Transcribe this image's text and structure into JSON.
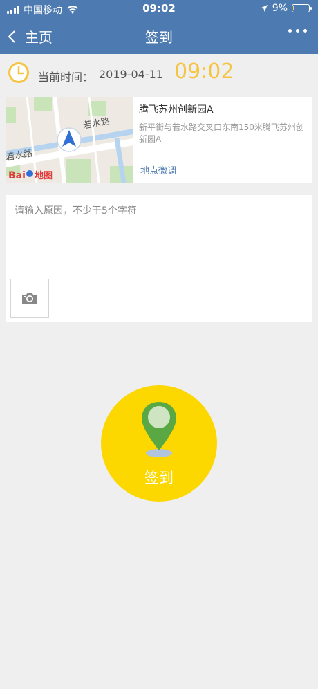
{
  "status_bar": {
    "carrier": "中国移动",
    "time": "09:02",
    "battery": "9%",
    "battery_level": 0.09
  },
  "nav": {
    "back_label": "主页",
    "title": "签到"
  },
  "checkin": {
    "time_label": "当前时间：",
    "date": "2019-04-11",
    "time": "09:02"
  },
  "location": {
    "name": "腾飞苏州创新园A",
    "address": "新平街与若水路交叉口东南150米腾飞苏州创新园A",
    "adjust_label": "地点微调",
    "map": {
      "road_label_1": "若水路",
      "road_label_2": "若水路",
      "brand": "Baidu地图"
    }
  },
  "reason": {
    "placeholder": "请输入原因，不少于5个字符",
    "value": ""
  },
  "signin_button": {
    "label": "签到",
    "color": "#fcd700"
  },
  "colors": {
    "header": "#4d7bb1",
    "accent_time": "#f5c542",
    "link": "#4d7bb1"
  },
  "icons": [
    "signal-icon",
    "wifi-icon",
    "location-arrow-icon",
    "battery-icon",
    "back-chevron-icon",
    "more-icon",
    "clock-icon",
    "navigation-arrow-icon",
    "camera-icon",
    "map-pin-icon"
  ]
}
